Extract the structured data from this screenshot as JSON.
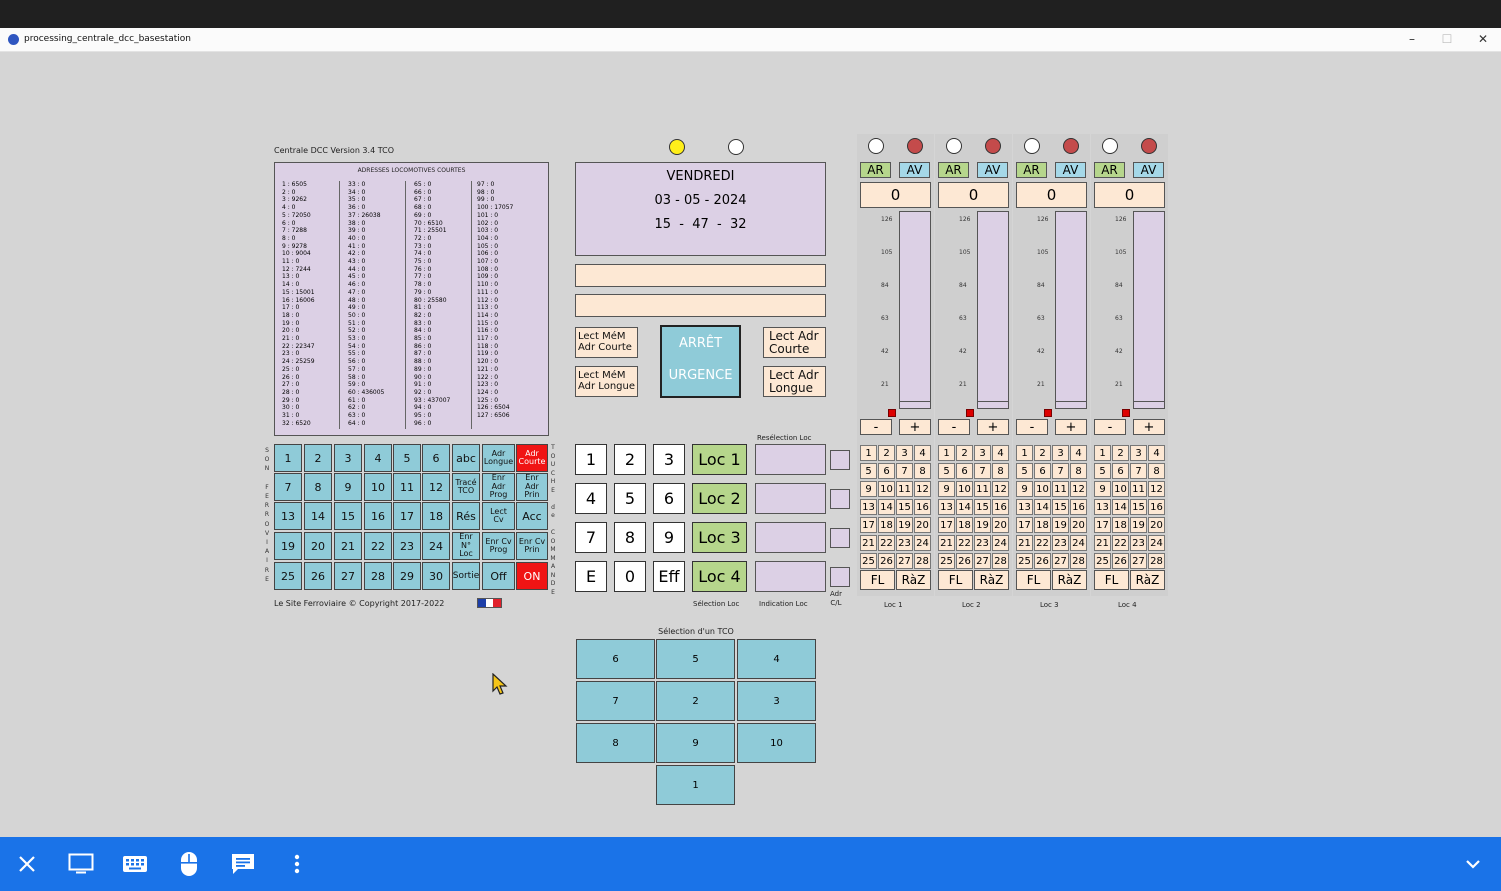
{
  "window": {
    "title": "processing_centrale_dcc_basestation"
  },
  "header": {
    "version": "Centrale DCC Version 3.4 TCO",
    "copyright": "Le Site Ferroviaire © Copyright 2017-2022"
  },
  "addresses": {
    "title": "ADRESSES LOCOMOTIVES COURTES",
    "columns": [
      [
        "1 : 6505",
        "2 : 0",
        "3 : 9262",
        "4 : 0",
        "5 : 72050",
        "6 : 0",
        "7 : 7288",
        "8 : 0",
        "9 : 9278",
        "10 : 9004",
        "11 : 0",
        "12 : 7244",
        "13 : 0",
        "14 : 0",
        "15 : 15001",
        "16 : 16006",
        "17 : 0",
        "18 : 0",
        "19 : 0",
        "20 : 0",
        "21 : 0",
        "22 : 22347",
        "23 : 0",
        "24 : 25259",
        "25 : 0",
        "26 : 0",
        "27 : 0",
        "28 : 0",
        "29 : 0",
        "30 : 0",
        "31 : 0",
        "32 : 6520"
      ],
      [
        "33 : 0",
        "34 : 0",
        "35 : 0",
        "36 : 0",
        "37 : 26038",
        "38 : 0",
        "39 : 0",
        "40 : 0",
        "41 : 0",
        "42 : 0",
        "43 : 0",
        "44 : 0",
        "45 : 0",
        "46 : 0",
        "47 : 0",
        "48 : 0",
        "49 : 0",
        "50 : 0",
        "51 : 0",
        "52 : 0",
        "53 : 0",
        "54 : 0",
        "55 : 0",
        "56 : 0",
        "57 : 0",
        "58 : 0",
        "59 : 0",
        "60 : 436005",
        "61 : 0",
        "62 : 0",
        "63 : 0",
        "64 : 0"
      ],
      [
        "65 : 0",
        "66 : 0",
        "67 : 0",
        "68 : 0",
        "69 : 0",
        "70 : 6510",
        "71 : 25501",
        "72 : 0",
        "73 : 0",
        "74 : 0",
        "75 : 0",
        "76 : 0",
        "77 : 0",
        "78 : 0",
        "79 : 0",
        "80 : 25580",
        "81 : 0",
        "82 : 0",
        "83 : 0",
        "84 : 0",
        "85 : 0",
        "86 : 0",
        "87 : 0",
        "88 : 0",
        "89 : 0",
        "90 : 0",
        "91 : 0",
        "92 : 0",
        "93 : 437007",
        "94 : 0",
        "95 : 0",
        "96 : 0"
      ],
      [
        "97 : 0",
        "98 : 0",
        "99 : 0",
        "100 : 17057",
        "101 : 0",
        "102 : 0",
        "103 : 0",
        "104 : 0",
        "105 : 0",
        "106 : 0",
        "107 : 0",
        "108 : 0",
        "109 : 0",
        "110 : 0",
        "111 : 0",
        "112 : 0",
        "113 : 0",
        "114 : 0",
        "115 : 0",
        "116 : 0",
        "117 : 0",
        "118 : 0",
        "119 : 0",
        "120 : 0",
        "121 : 0",
        "122 : 0",
        "123 : 0",
        "124 : 0",
        "125 : 0",
        "126 : 6504",
        "127 : 6506",
        ""
      ]
    ]
  },
  "sound_keypad": {
    "rows": [
      [
        "1",
        "2",
        "3",
        "4",
        "5",
        "6",
        "abc",
        "Adr|Longue",
        "Adr|Courte"
      ],
      [
        "7",
        "8",
        "9",
        "10",
        "11",
        "12",
        "Tracé|TCO",
        "Enr|Adr|Prog",
        "Enr|Adr|Prin"
      ],
      [
        "13",
        "14",
        "15",
        "16",
        "17",
        "18",
        "Rés",
        "Lect|Cv",
        "Acc"
      ],
      [
        "19",
        "20",
        "21",
        "22",
        "23",
        "24",
        "Enr|N°|Loc",
        "Enr Cv|Prog",
        "Enr Cv|Prin"
      ],
      [
        "25",
        "26",
        "27",
        "28",
        "29",
        "30",
        "Sortie",
        "Off",
        "ON"
      ]
    ],
    "left_label": [
      "S",
      "O",
      "N",
      "",
      "F",
      "E",
      "R",
      "R",
      "O",
      "V",
      "I",
      "A",
      "I",
      "R",
      "E"
    ],
    "right_label": [
      "T",
      "O",
      "U",
      "C",
      "H",
      "E",
      "",
      "d",
      "e",
      "",
      "C",
      "O",
      "M",
      "M",
      "A",
      "N",
      "D",
      "E"
    ],
    "red_keys": [
      "Adr|Courte",
      "ON"
    ]
  },
  "date_panel": {
    "day": "VENDREDI",
    "date": "03 - 05 - 2024",
    "time": "15  -  47  -  32"
  },
  "buttons": {
    "lect_mem_courte": "Lect MéM|Adr Courte",
    "lect_mem_longue": "Lect MéM|Adr Longue",
    "lect_adr_courte": "Lect Adr|Courte",
    "lect_adr_longue": "Lect Adr|Longue",
    "emergency_line1": "ARRÊT",
    "emergency_line2": "URGENCE"
  },
  "numpad": {
    "keys": [
      "1",
      "2",
      "3",
      "4",
      "5",
      "6",
      "7",
      "8",
      "9",
      "E",
      "0",
      "Eff"
    ]
  },
  "loc_select": {
    "locs": [
      "Loc 1",
      "Loc 2",
      "Loc 3",
      "Loc 4"
    ],
    "reselect_label": "Resélection Loc",
    "selection_label": "Sélection Loc",
    "indication_label": "Indication Loc",
    "adr_label": "Adr|C/L"
  },
  "throttles": {
    "names": [
      "Loc 1",
      "Loc 2",
      "Loc 3",
      "Loc 4"
    ],
    "ar": "AR",
    "av": "AV",
    "speed": "0",
    "ticks": [
      "126",
      "105",
      "84",
      "63",
      "42",
      "21"
    ],
    "minus": "-",
    "plus": "+",
    "fl": "FL",
    "raz": "RàZ",
    "functions": [
      "1",
      "2",
      "3",
      "4",
      "5",
      "6",
      "7",
      "8",
      "9",
      "10",
      "11",
      "12",
      "13",
      "14",
      "15",
      "16",
      "17",
      "18",
      "19",
      "20",
      "21",
      "22",
      "23",
      "24",
      "25",
      "26",
      "27",
      "28"
    ],
    "speed_level": 0
  },
  "tco": {
    "title": "Sélection d'un TCO",
    "rows": [
      [
        "6",
        "5",
        "4"
      ],
      [
        "7",
        "2",
        "3"
      ],
      [
        "8",
        "9",
        "10"
      ],
      [
        "1"
      ]
    ]
  },
  "colors": {
    "tile": "#8fcbd8",
    "purple": "#dcd0e5",
    "peach": "#fde8d4",
    "green": "#b6d68c",
    "red": "#f01414",
    "taskbar": "#1a73e8"
  },
  "taskbar": {
    "icons": [
      "close-icon",
      "monitor-icon",
      "keyboard-icon",
      "mouse-icon",
      "chat-icon",
      "more-icon",
      "chevron-down-icon"
    ]
  }
}
